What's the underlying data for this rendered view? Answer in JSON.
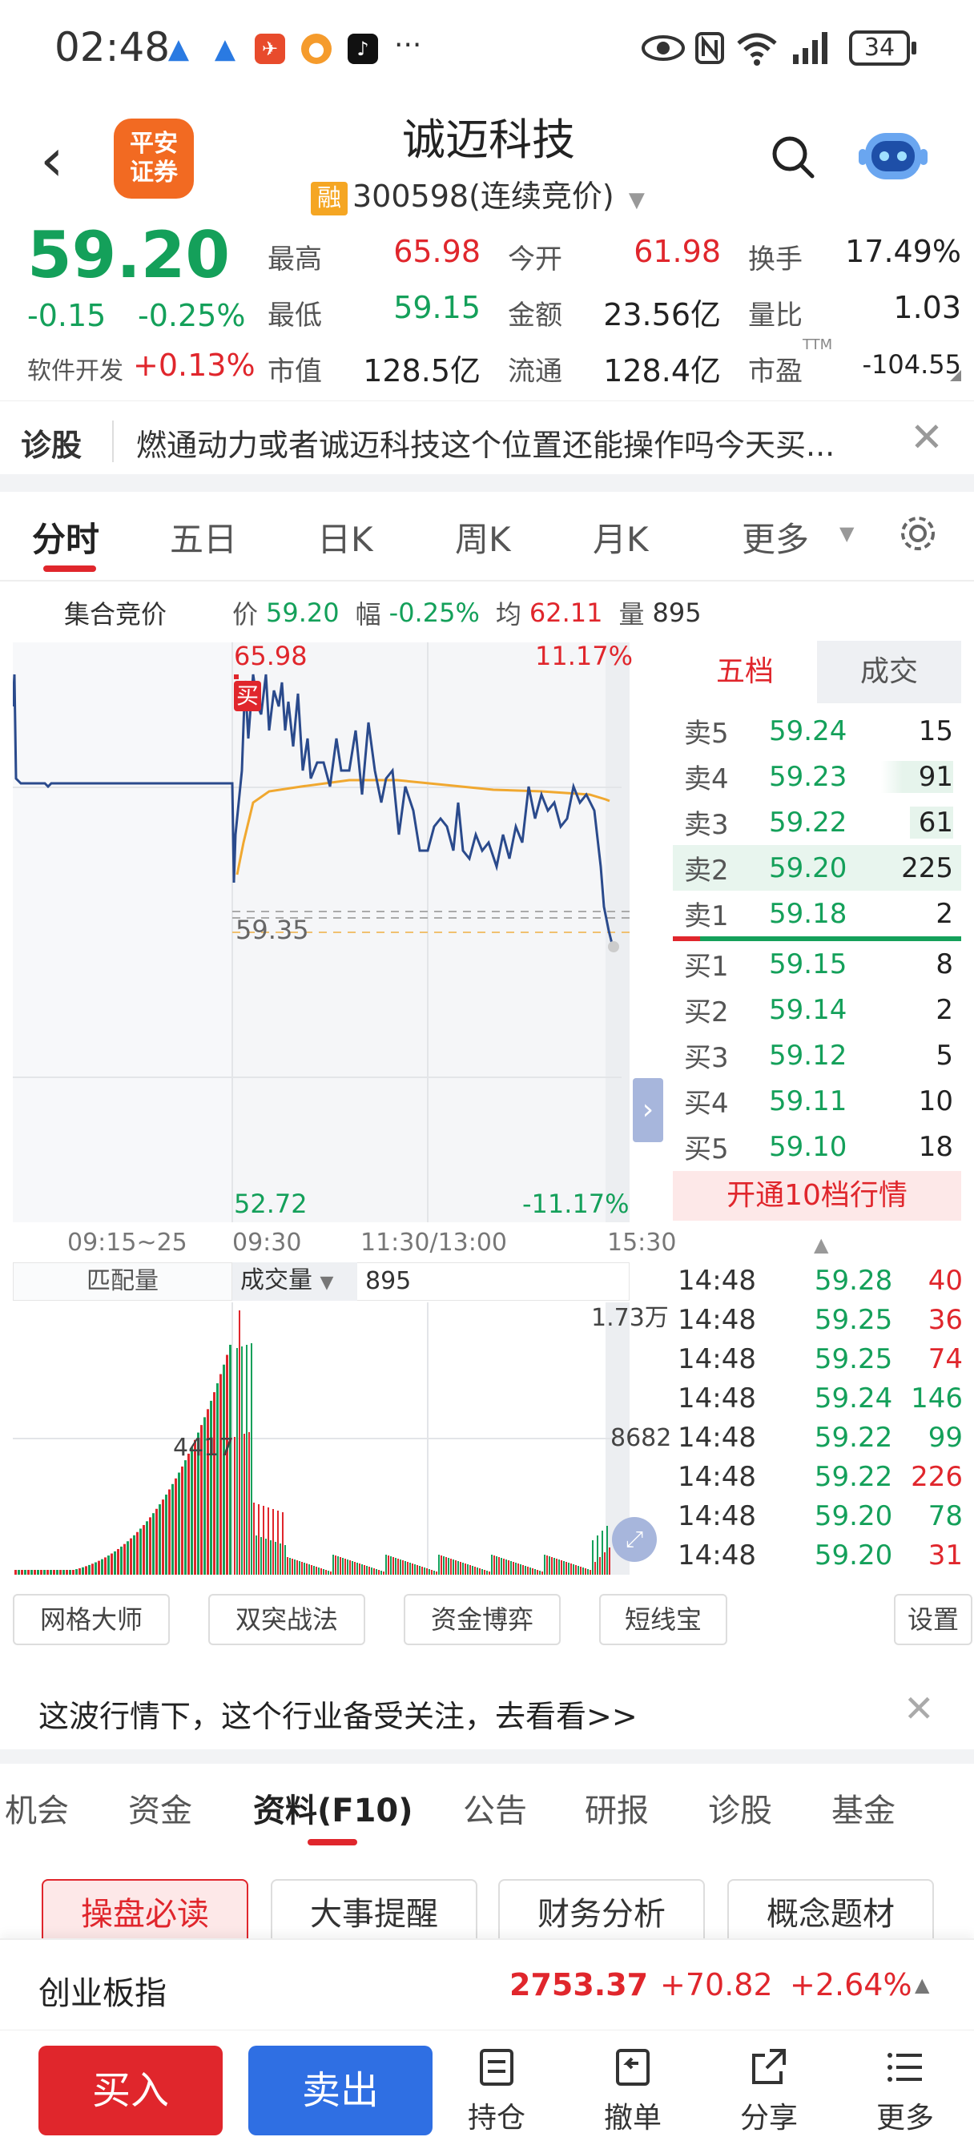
{
  "status": {
    "time": "02:48",
    "battery": "34",
    "more": "···"
  },
  "header": {
    "title": "诚迈科技",
    "rong": "融",
    "code": "300598",
    "mode": "(连续竞价)",
    "logo_line1": "平安",
    "logo_line2": "证券"
  },
  "quote": {
    "price": "59.20",
    "change": "-0.15",
    "change_pct": "-0.25%",
    "sector": "软件开发",
    "sector_pct": "+0.13%",
    "high_label": "最高",
    "high": "65.98",
    "open_label": "今开",
    "open": "61.98",
    "turnover_label": "换手",
    "turnover": "17.49%",
    "low_label": "最低",
    "low": "59.15",
    "amount_label": "金额",
    "amount": "23.56亿",
    "volratio_label": "量比",
    "volratio": "1.03",
    "mktcap_label": "市值",
    "mktcap": "128.5亿",
    "float_label": "流通",
    "float": "128.4亿",
    "pe_label": "市盈",
    "pe_sup": "TTM",
    "pe": "-104.55"
  },
  "diagnose": {
    "label": "诊股",
    "text": "燃通动力或者诚迈科技这个位置还能操作吗今天买..."
  },
  "tabs": [
    "分时",
    "五日",
    "日K",
    "周K",
    "月K",
    "更多"
  ],
  "chart_info": {
    "auction": "集合竞价",
    "price_label": "价",
    "price": "59.20",
    "amp_label": "幅",
    "amp": "-0.25%",
    "avg_label": "均",
    "avg": "62.11",
    "vol_label": "量",
    "vol": "895"
  },
  "chart": {
    "top_price": "65.98",
    "top_pct": "11.17%",
    "bottom_price": "52.72",
    "bottom_pct": "-11.17%",
    "mid_price": "59.35",
    "buy_tag": "买",
    "time_labels": [
      "09:15~25",
      "09:30",
      "11:30/13:00",
      "15:30"
    ],
    "vol_left_label": "匹配量",
    "vol_select": "成交量",
    "vol_value": "895",
    "vol_top": "1.73万",
    "vol_mid": "8682",
    "vol_left": "4417"
  },
  "orderbook": {
    "tab_five": "五档",
    "tab_trades": "成交",
    "asks": [
      {
        "label": "卖5",
        "price": "59.24",
        "vol": "15"
      },
      {
        "label": "卖4",
        "price": "59.23",
        "vol": "91"
      },
      {
        "label": "卖3",
        "price": "59.22",
        "vol": "61"
      },
      {
        "label": "卖2",
        "price": "59.20",
        "vol": "225"
      },
      {
        "label": "卖1",
        "price": "59.18",
        "vol": "2"
      }
    ],
    "bids": [
      {
        "label": "买1",
        "price": "59.15",
        "vol": "8"
      },
      {
        "label": "买2",
        "price": "59.14",
        "vol": "2"
      },
      {
        "label": "买3",
        "price": "59.12",
        "vol": "5"
      },
      {
        "label": "买4",
        "price": "59.11",
        "vol": "10"
      },
      {
        "label": "买5",
        "price": "59.10",
        "vol": "18"
      }
    ],
    "upgrade": "开通10档行情"
  },
  "trades": [
    {
      "time": "14:48",
      "price": "59.28",
      "vol": "40",
      "dir": "buy"
    },
    {
      "time": "14:48",
      "price": "59.25",
      "vol": "36",
      "dir": "buy"
    },
    {
      "time": "14:48",
      "price": "59.25",
      "vol": "74",
      "dir": "buy"
    },
    {
      "time": "14:48",
      "price": "59.24",
      "vol": "146",
      "dir": "sell"
    },
    {
      "time": "14:48",
      "price": "59.22",
      "vol": "99",
      "dir": "sell"
    },
    {
      "time": "14:48",
      "price": "59.22",
      "vol": "226",
      "dir": "buy"
    },
    {
      "time": "14:48",
      "price": "59.20",
      "vol": "78",
      "dir": "sell"
    },
    {
      "time": "14:48",
      "price": "59.20",
      "vol": "31",
      "dir": "buy"
    }
  ],
  "tools": [
    "网格大师",
    "双突战法",
    "资金博弈",
    "短线宝"
  ],
  "tools_settings": "设置",
  "banner": "这波行情下，这个行业备受关注，去看看>>",
  "bottom_tabs": [
    "机会",
    "资金",
    "资料(F10)",
    "公告",
    "研报",
    "诊股",
    "基金"
  ],
  "f10_chips": [
    "操盘必读",
    "大事提醒",
    "财务分析",
    "概念题材"
  ],
  "index": {
    "name": "创业板指",
    "value": "2753.37",
    "change": "+70.82",
    "pct": "+2.64%"
  },
  "actions": {
    "buy": "买入",
    "sell": "卖出"
  },
  "nav": [
    "持仓",
    "撤单",
    "分享",
    "更多"
  ],
  "colors": {
    "up": "#e0262c",
    "down": "#14a05a",
    "line": "#2a4a8c",
    "avg": "#f0a830",
    "sell_btn": "#2f6fe3"
  }
}
